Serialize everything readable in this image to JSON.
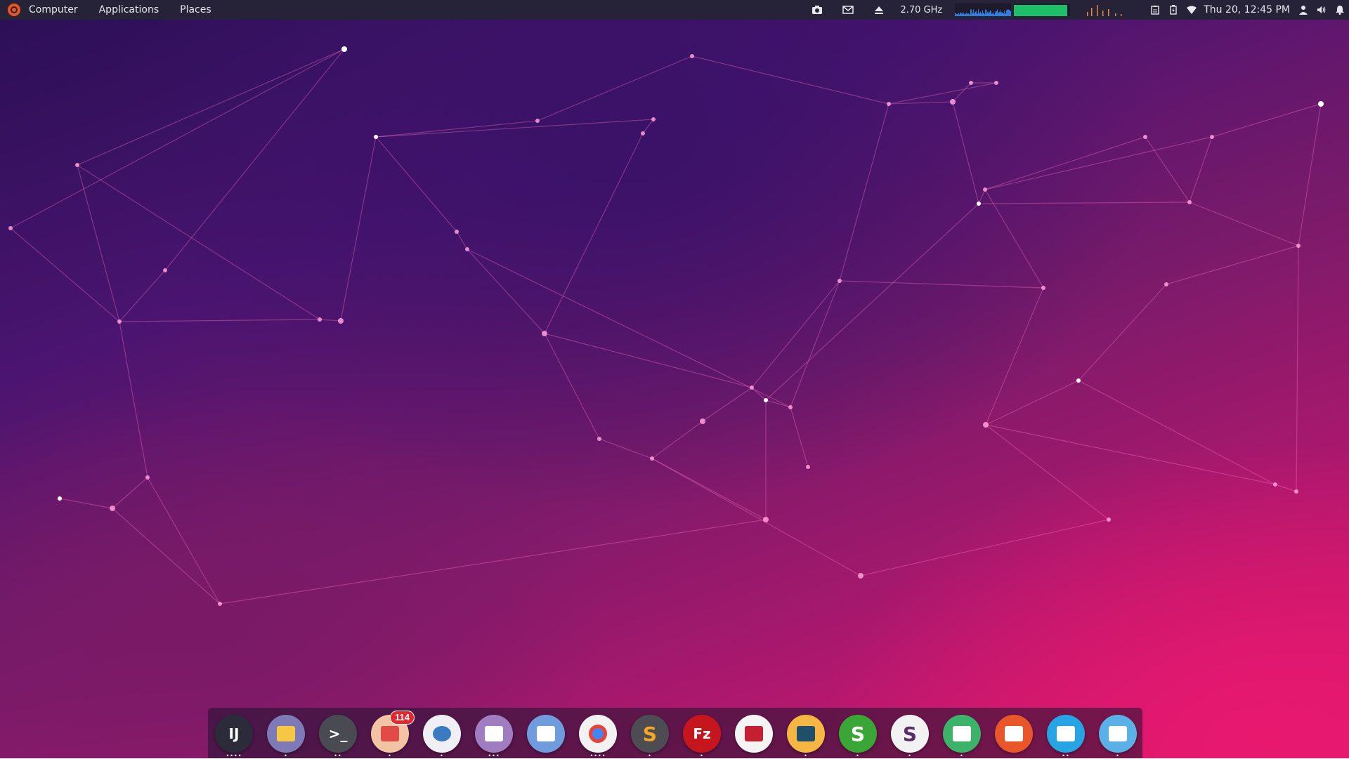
{
  "top_panel": {
    "menus": [
      "Computer",
      "Applications",
      "Places"
    ],
    "cpu_frequency": "2.70 GHz",
    "memory_usage_fraction": 0.95,
    "clock": "Thu 20, 12:45 PM"
  },
  "tray_icons": [
    "camera-icon",
    "mail-icon",
    "eject-icon",
    "clipboard-icon",
    "battery-icon",
    "wifi-icon",
    "user-icon",
    "volume-icon",
    "bell-icon"
  ],
  "dock": {
    "apps": [
      {
        "name": "intellij-idea",
        "icon": "intellij-icon",
        "label": "IJ",
        "bg": "#2b2b3a",
        "fg": "#ffffff",
        "dots": "••••"
      },
      {
        "name": "files",
        "icon": "folder-icon",
        "label": "",
        "bg": "#7e7ab8",
        "fg": "#f6c744",
        "dots": "•"
      },
      {
        "name": "terminal",
        "icon": "terminal-icon",
        "label": ">_",
        "bg": "#4a4a52",
        "fg": "#ffffff",
        "dots": "••"
      },
      {
        "name": "mail-client",
        "icon": "mail-icon",
        "label": "",
        "bg": "#f3c4a4",
        "fg": "#e24a4a",
        "dots": "•",
        "badge": "114"
      },
      {
        "name": "shutter",
        "icon": "camera-shutter-icon",
        "label": "",
        "bg": "#f0f0f4",
        "fg": "#3a7ac0",
        "dots": "•"
      },
      {
        "name": "text-editor",
        "icon": "document-icon",
        "label": "",
        "bg": "#a07cc0",
        "fg": "#ffffff",
        "dots": "•••"
      },
      {
        "name": "remote-viewer",
        "icon": "window-icon",
        "label": "",
        "bg": "#6f9cdc",
        "fg": "#ffffff",
        "dots": ""
      },
      {
        "name": "chrome",
        "icon": "chrome-icon",
        "label": "",
        "bg": "#f2f2f2",
        "fg": "#4285f4",
        "dots": "••••"
      },
      {
        "name": "sublime-text",
        "icon": "sublime-icon",
        "label": "S",
        "bg": "#4c4c52",
        "fg": "#f5a623",
        "dots": "•"
      },
      {
        "name": "filezilla",
        "icon": "filezilla-icon",
        "label": "Fz",
        "bg": "#c4161c",
        "fg": "#ffffff",
        "dots": "•"
      },
      {
        "name": "remmina",
        "icon": "remote-desktop-icon",
        "label": "",
        "bg": "#f4f4f4",
        "fg": "#c42032",
        "dots": ""
      },
      {
        "name": "mysql-workbench",
        "icon": "dolphin-icon",
        "label": "",
        "bg": "#f5b642",
        "fg": "#1f4f6a",
        "dots": "•"
      },
      {
        "name": "simplenote",
        "icon": "s-letter-icon",
        "label": "S",
        "bg": "#3aa635",
        "fg": "#ffffff",
        "dots": "•"
      },
      {
        "name": "slack",
        "icon": "slack-icon",
        "label": "S",
        "bg": "#f2f2f2",
        "fg": "#5a2d6a",
        "dots": "•"
      },
      {
        "name": "spreadsheet",
        "icon": "spreadsheet-icon",
        "label": "",
        "bg": "#3db36a",
        "fg": "#ffffff",
        "dots": "•"
      },
      {
        "name": "postman-like",
        "icon": "pen-icon",
        "label": "",
        "bg": "#e8562a",
        "fg": "#ffffff",
        "dots": ""
      },
      {
        "name": "system-monitor",
        "icon": "monitor-graph-icon",
        "label": "",
        "bg": "#27a4e3",
        "fg": "#ffffff",
        "dots": "••"
      },
      {
        "name": "settings",
        "icon": "settings-icon",
        "label": "",
        "bg": "#5bb0e8",
        "fg": "#ffffff",
        "dots": "•"
      }
    ]
  }
}
